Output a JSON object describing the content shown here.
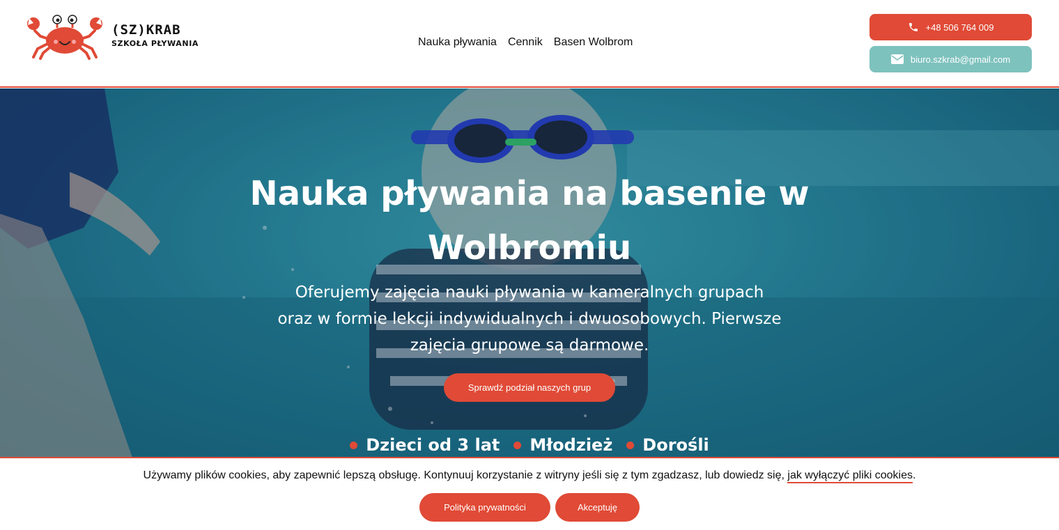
{
  "brand": {
    "title": "(SZ)KRAB",
    "subtitle": "SZKOŁA PŁYWANIA",
    "icon": "crab-logo-icon"
  },
  "nav": {
    "items": [
      "Nauka pływania",
      "Cennik",
      "Basen Wolbrom"
    ]
  },
  "contact": {
    "phone": "+48 506 764 009",
    "email": "biuro.szkrab@gmail.com",
    "phone_icon": "phone-icon",
    "email_icon": "envelope-icon"
  },
  "hero": {
    "title_line1": "Nauka pływania na basenie w",
    "title_line2": "Wolbromiu",
    "text_line1": "Oferujemy zajęcia nauki pływania w kameralnych grupach",
    "text_line2": "oraz w formie lekcji indywidualnych i dwuosobowych. Pierwsze",
    "text_line3": "zajęcia grupowe są darmowe.",
    "cta": "Sprawdź podział naszych grup",
    "audience": [
      "Dzieci od 3 lat",
      "Młodzież",
      "Dorośli"
    ]
  },
  "cookie": {
    "text": "Używamy plików cookies, aby zapewnić lepszą obsługę. Kontynuuj korzystanie z witryny jeśli się z tym zgadzasz, lub dowiedz się,",
    "link": "jak wyłączyć pliki cookies",
    "end": ".",
    "privacy_btn": "Polityka prywatności",
    "accept_btn": "Akceptuję"
  },
  "colors": {
    "accent": "#e04a36",
    "mint": "#7ec2be",
    "water": "#2c8fa5"
  }
}
